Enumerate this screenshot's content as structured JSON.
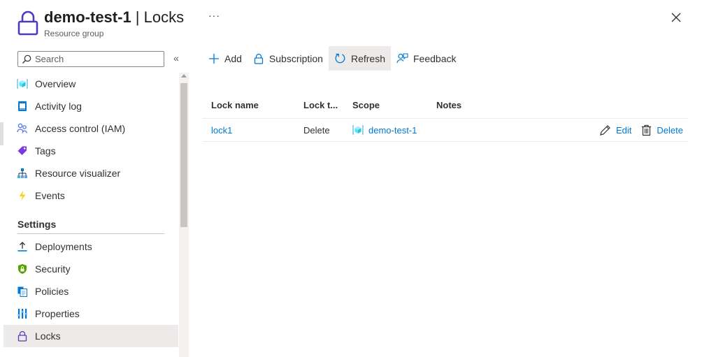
{
  "header": {
    "resource_name": "demo-test-1",
    "separator": " | ",
    "page_name": "Locks",
    "subtitle": "Resource group",
    "more_label": "···"
  },
  "sidebar": {
    "search_placeholder": "Search",
    "collapse_label": "«",
    "items": [
      {
        "label": "Overview",
        "icon": "resource-group-cube-icon"
      },
      {
        "label": "Activity log",
        "icon": "activity-log-icon"
      },
      {
        "label": "Access control (IAM)",
        "icon": "people-icon"
      },
      {
        "label": "Tags",
        "icon": "tag-icon"
      },
      {
        "label": "Resource visualizer",
        "icon": "hierarchy-icon"
      },
      {
        "label": "Events",
        "icon": "lightning-icon"
      }
    ],
    "settings_header": "Settings",
    "settings_items": [
      {
        "label": "Deployments",
        "icon": "upload-icon"
      },
      {
        "label": "Security",
        "icon": "shield-icon"
      },
      {
        "label": "Policies",
        "icon": "policy-document-icon"
      },
      {
        "label": "Properties",
        "icon": "properties-bars-icon"
      },
      {
        "label": "Locks",
        "icon": "lock-icon",
        "active": true
      }
    ]
  },
  "toolbar": {
    "add": "Add",
    "subscription": "Subscription",
    "refresh": "Refresh",
    "feedback": "Feedback"
  },
  "grid": {
    "columns": [
      "Lock name",
      "Lock t...",
      "Scope",
      "Notes"
    ],
    "rows": [
      {
        "name": "lock1",
        "type": "Delete",
        "scope": "demo-test-1",
        "notes": "",
        "edit": "Edit",
        "delete": "Delete"
      }
    ]
  },
  "colors": {
    "accent": "#0078d4",
    "lock_icon": "#4f3bb6",
    "active_bg": "#edebe9",
    "text": "#323130"
  }
}
